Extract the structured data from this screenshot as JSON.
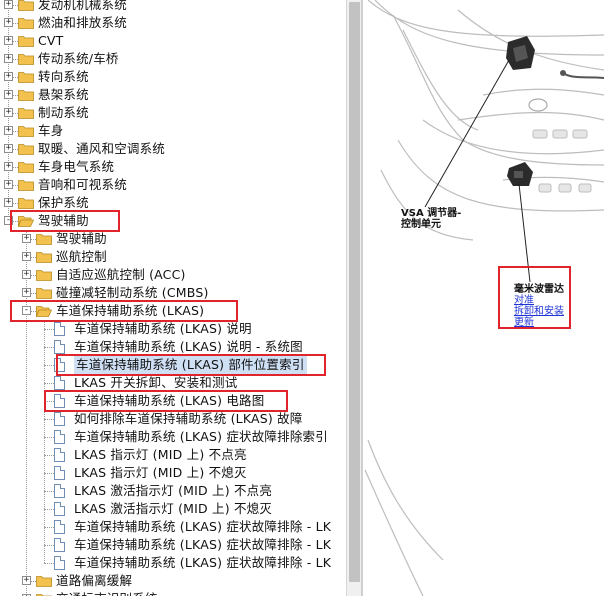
{
  "tree": {
    "items": [
      {
        "label": "发动机机械系统",
        "level": 0,
        "type": "folder",
        "expander": "+"
      },
      {
        "label": "燃油和排放系统",
        "level": 0,
        "type": "folder",
        "expander": "+"
      },
      {
        "label": "CVT",
        "level": 0,
        "type": "folder",
        "expander": "+"
      },
      {
        "label": "传动系统/车桥",
        "level": 0,
        "type": "folder",
        "expander": "+"
      },
      {
        "label": "转向系统",
        "level": 0,
        "type": "folder",
        "expander": "+"
      },
      {
        "label": "悬架系统",
        "level": 0,
        "type": "folder",
        "expander": "+"
      },
      {
        "label": "制动系统",
        "level": 0,
        "type": "folder",
        "expander": "+"
      },
      {
        "label": "车身",
        "level": 0,
        "type": "folder",
        "expander": "+"
      },
      {
        "label": "取暖、通风和空调系统",
        "level": 0,
        "type": "folder",
        "expander": "+"
      },
      {
        "label": "车身电气系统",
        "level": 0,
        "type": "folder",
        "expander": "+"
      },
      {
        "label": "音响和可视系统",
        "level": 0,
        "type": "folder",
        "expander": "+"
      },
      {
        "label": "保护系统",
        "level": 0,
        "type": "folder",
        "expander": "+"
      },
      {
        "label": "驾驶辅助",
        "level": 0,
        "type": "folder-open",
        "expander": "-"
      },
      {
        "label": "驾驶辅助",
        "level": 1,
        "type": "folder",
        "expander": "+"
      },
      {
        "label": "巡航控制",
        "level": 1,
        "type": "folder",
        "expander": "+"
      },
      {
        "label": "自适应巡航控制 (ACC)",
        "level": 1,
        "type": "folder",
        "expander": "+"
      },
      {
        "label": "碰撞减轻制动系统 (CMBS)",
        "level": 1,
        "type": "folder",
        "expander": "+"
      },
      {
        "label": "车道保持辅助系统 (LKAS)",
        "level": 1,
        "type": "folder-open",
        "expander": "-"
      },
      {
        "label": "车道保持辅助系统 (LKAS) 说明",
        "level": 2,
        "type": "doc"
      },
      {
        "label": "车道保持辅助系统 (LKAS) 说明 - 系统图",
        "level": 2,
        "type": "doc"
      },
      {
        "label": "车道保持辅助系统 (LKAS) 部件位置索引",
        "level": 2,
        "type": "doc",
        "selected": true
      },
      {
        "label": "LKAS 开关拆卸、安装和测试",
        "level": 2,
        "type": "doc"
      },
      {
        "label": "车道保持辅助系统 (LKAS) 电路图",
        "level": 2,
        "type": "doc"
      },
      {
        "label": "如何排除车道保持辅助系统 (LKAS) 故障",
        "level": 2,
        "type": "doc"
      },
      {
        "label": "车道保持辅助系统 (LKAS) 症状故障排除索引",
        "level": 2,
        "type": "doc"
      },
      {
        "label": "LKAS 指示灯 (MID 上) 不点亮",
        "level": 2,
        "type": "doc"
      },
      {
        "label": "LKAS 指示灯 (MID 上) 不熄灭",
        "level": 2,
        "type": "doc"
      },
      {
        "label": "LKAS 激活指示灯 (MID 上) 不点亮",
        "level": 2,
        "type": "doc"
      },
      {
        "label": "LKAS 激活指示灯 (MID 上) 不熄灭",
        "level": 2,
        "type": "doc"
      },
      {
        "label": "车道保持辅助系统 (LKAS) 症状故障排除 - LK",
        "level": 2,
        "type": "doc"
      },
      {
        "label": "车道保持辅助系统 (LKAS) 症状故障排除 - LK",
        "level": 2,
        "type": "doc"
      },
      {
        "label": "车道保持辅助系统 (LKAS) 症状故障排除 - LK",
        "level": 2,
        "type": "doc"
      },
      {
        "label": "道路偏离缓解",
        "level": 1,
        "type": "folder",
        "expander": "+"
      },
      {
        "label": "交通标志识别系统",
        "level": 1,
        "type": "folder",
        "expander": "+"
      }
    ]
  },
  "illustration": {
    "vsa_label_line1": "VSA 调节器-",
    "vsa_label_line2": "控制单元",
    "radar_title": "毫米波雷达",
    "radar_links": [
      "对准",
      "拆卸和安装",
      "更新"
    ]
  },
  "colors": {
    "highlight_box": "#e0242b",
    "selected_bg": "#cfe0f5",
    "link": "#1d33d6",
    "folder": "#f2c14e"
  }
}
